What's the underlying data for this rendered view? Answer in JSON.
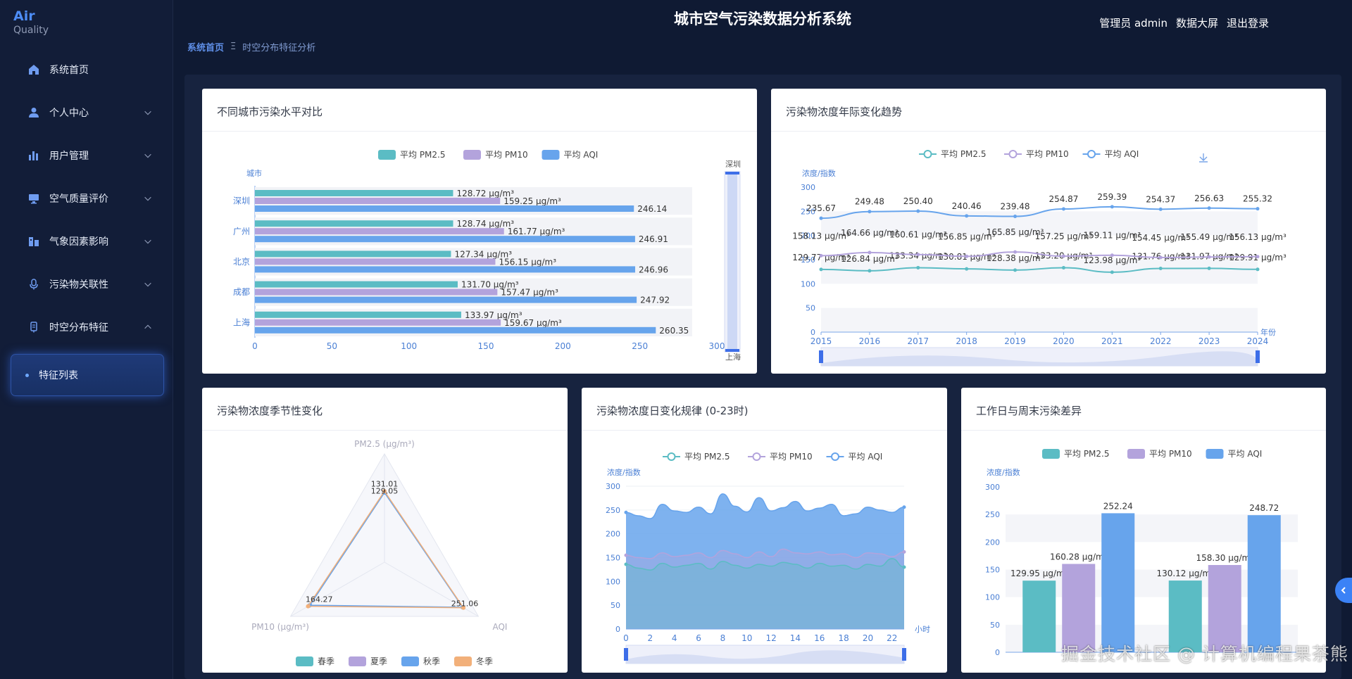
{
  "app": {
    "logo_top": "Air",
    "logo_bottom": "Quality",
    "title": "城市空气污染数据分析系统",
    "header_links": [
      "管理员 admin",
      "数据大屏",
      "退出登录"
    ]
  },
  "breadcrumb": {
    "home": "系统首页",
    "sep": "Ξ",
    "current": "时空分布特征分析"
  },
  "sidebar": {
    "items": [
      {
        "label": "系统首页",
        "icon": "home-icon",
        "chevron": "none"
      },
      {
        "label": "个人中心",
        "icon": "user-icon",
        "chevron": "down"
      },
      {
        "label": "用户管理",
        "icon": "bar-chart-icon",
        "chevron": "down"
      },
      {
        "label": "空气质量评价",
        "icon": "monitor-icon",
        "chevron": "down"
      },
      {
        "label": "气象因素影响",
        "icon": "building-icon",
        "chevron": "down"
      },
      {
        "label": "污染物关联性",
        "icon": "microphone-icon",
        "chevron": "down"
      },
      {
        "label": "时空分布特征",
        "icon": "device-icon",
        "chevron": "up"
      }
    ],
    "submenu_item": "特征列表"
  },
  "colors": {
    "pm25": "#5bbcc4",
    "pm10": "#b3a3dc",
    "aqi": "#67a4ec"
  },
  "charts": {
    "city": {
      "title": "不同城市污染水平对比",
      "chart_data": {
        "type": "bar",
        "orientation": "horizontal",
        "legend": [
          "平均 PM2.5",
          "平均 PM10",
          "平均 AQI"
        ],
        "axis_name_y": "城市",
        "categories": [
          "深圳",
          "广州",
          "北京",
          "成都",
          "上海"
        ],
        "series": [
          {
            "name": "平均 PM2.5",
            "values": [
              128.72,
              128.74,
              127.34,
              131.7,
              133.97
            ],
            "labels": [
              "128.72 μg/m³",
              "128.74 μg/m³",
              "127.34 μg/m³",
              "131.70 μg/m³",
              "133.97 μg/m³"
            ]
          },
          {
            "name": "平均 PM10",
            "values": [
              159.25,
              161.77,
              156.15,
              157.47,
              159.67
            ],
            "labels": [
              "159.25 μg/m³",
              "161.77 μg/m³",
              "156.15 μg/m³",
              "157.47 μg/m³",
              "159.67 μg/m³"
            ]
          },
          {
            "name": "平均 AQI",
            "values": [
              246.14,
              246.91,
              246.96,
              247.92,
              260.35
            ],
            "labels": [
              "246.14",
              "246.91",
              "246.96",
              "247.92",
              "260.35"
            ]
          }
        ],
        "x_ticks": [
          "0",
          "50",
          "100",
          "150",
          "200",
          "250",
          "300"
        ],
        "xlim": [
          0,
          300
        ],
        "zoom_labels": [
          "深圳",
          "上海"
        ]
      }
    },
    "yearly": {
      "title": "污染物浓度年际变化趋势",
      "chart_data": {
        "type": "line",
        "legend": [
          "平均 PM2.5",
          "平均 PM10",
          "平均 AQI"
        ],
        "axis_name_y": "浓度/指数",
        "axis_name_x": "年份",
        "x": [
          "2015",
          "2016",
          "2017",
          "2018",
          "2019",
          "2020",
          "2021",
          "2022",
          "2023",
          "2024"
        ],
        "y_ticks": [
          "0",
          "50",
          "100",
          "150",
          "200",
          "250",
          "300"
        ],
        "ylim": [
          0,
          300
        ],
        "series": [
          {
            "name": "平均 PM2.5",
            "values": [
              129.77,
              126.84,
              133.34,
              130.81,
              128.38,
              133.2,
              123.98,
              131.76,
              131.97,
              129.91
            ],
            "labels": [
              "129.77 μg/m³",
              "126.84 μg/m³",
              "133.34 μg/m³",
              "130.81 μg/m³",
              "128.38 μg/m³",
              "133.20 μg/m³",
              "123.98 μg/m³",
              "131.76 μg/m³",
              "131.97 μg/m³",
              "129.91 μg/m³"
            ]
          },
          {
            "name": "平均 PM10",
            "values": [
              158.13,
              164.66,
              160.61,
              156.85,
              165.85,
              157.25,
              159.11,
              154.45,
              155.49,
              156.13
            ],
            "labels": [
              "158.13 μg/m³",
              "164.66 μg/m³",
              "160.61 μg/m³",
              "156.85 μg/m³",
              "165.85 μg/m³",
              "157.25 μg/m³",
              "159.11 μg/m³",
              "154.45 μg/m³",
              "155.49 μg/m³",
              "156.13 μg/m³"
            ]
          },
          {
            "name": "平均 AQI",
            "values": [
              235.67,
              249.48,
              250.4,
              240.46,
              239.48,
              254.87,
              259.39,
              254.37,
              256.63,
              255.32
            ],
            "labels": [
              "235.67",
              "249.48",
              "250.40",
              "240.46",
              "239.48",
              "254.87",
              "259.39",
              "254.37",
              "256.63",
              "255.32"
            ]
          }
        ]
      }
    },
    "season": {
      "title": "污染物浓度季节性变化",
      "chart_data": {
        "type": "radar",
        "indicators": [
          "PM2.5 (μg/m³)",
          "PM10 (μg/m³)",
          "AQI"
        ],
        "max": [
          200,
          200,
          300
        ],
        "legend": [
          "春季",
          "夏季",
          "秋季",
          "冬季"
        ],
        "series": [
          {
            "name": "春季",
            "values": [
              129.05,
              160.2,
              250.5
            ]
          },
          {
            "name": "夏季",
            "values": [
              130.2,
              161.0,
              251.06
            ]
          },
          {
            "name": "秋季",
            "values": [
              128.4,
              158.7,
              249.6
            ]
          },
          {
            "name": "冬季",
            "values": [
              131.01,
              162.73,
              252.2
            ]
          }
        ],
        "labels": [
          "131.01",
          "129.05",
          "164.27",
          "251.06"
        ]
      }
    },
    "hourly": {
      "title": "污染物浓度日变化规律 (0-23时)",
      "chart_data": {
        "type": "area",
        "legend": [
          "平均 PM2.5",
          "平均 PM10",
          "平均 AQI"
        ],
        "axis_name_y": "浓度/指数",
        "axis_name_x": "小时",
        "x_ticks": [
          "0",
          "2",
          "4",
          "6",
          "8",
          "10",
          "12",
          "14",
          "16",
          "18",
          "20",
          "22"
        ],
        "y_ticks": [
          "0",
          "50",
          "100",
          "150",
          "200",
          "250",
          "300"
        ],
        "ylim": [
          0,
          300
        ],
        "x": [
          0,
          1,
          2,
          3,
          4,
          5,
          6,
          7,
          8,
          9,
          10,
          11,
          12,
          13,
          14,
          15,
          16,
          17,
          18,
          19,
          20,
          21,
          22,
          23
        ],
        "series": [
          {
            "name": "平均 AQI",
            "values": [
              245,
              238,
              232,
              262,
              248,
              245,
              256,
              242,
              284,
              258,
              246,
              276,
              248,
              255,
              268,
              248,
              254,
              262,
              238,
              242,
              256,
              250,
              245,
              256
            ]
          },
          {
            "name": "平均 PM10",
            "values": [
              155,
              150,
              148,
              160,
              152,
              155,
              160,
              150,
              165,
              158,
              150,
              162,
              152,
              168,
              160,
              158,
              162,
              156,
              158,
              150,
              160,
              158,
              152,
              162
            ]
          },
          {
            "name": "平均 PM2.5",
            "values": [
              136,
              128,
              124,
              138,
              130,
              134,
              138,
              126,
              142,
              134,
              128,
              136,
              132,
              140,
              136,
              128,
              138,
              132,
              134,
              126,
              136,
              132,
              148,
              130
            ]
          }
        ]
      }
    },
    "weekday": {
      "title": "工作日与周末污染差异",
      "chart_data": {
        "type": "bar",
        "legend": [
          "平均 PM2.5",
          "平均 PM10",
          "平均 AQI"
        ],
        "axis_name_y": "浓度/指数",
        "y_ticks": [
          "0",
          "50",
          "100",
          "150",
          "200",
          "250",
          "300"
        ],
        "ylim": [
          0,
          300
        ],
        "groups": 2,
        "series": [
          {
            "name": "平均 PM2.5",
            "values": [
              129.95,
              130.12
            ],
            "labels": [
              "129.95 μg/m³",
              "130.12 μg/m³"
            ]
          },
          {
            "name": "平均 PM10",
            "values": [
              160.28,
              158.3
            ],
            "labels": [
              "160.28 μg/m³",
              "158.30 μg/m³"
            ]
          },
          {
            "name": "平均 AQI",
            "values": [
              252.24,
              248.72
            ],
            "labels": [
              "252.24",
              "248.72"
            ]
          }
        ]
      }
    }
  },
  "watermark": "掘金技术社区 @ 计算机编程果茶熊",
  "side_handle_icon": "chevron-left-icon"
}
